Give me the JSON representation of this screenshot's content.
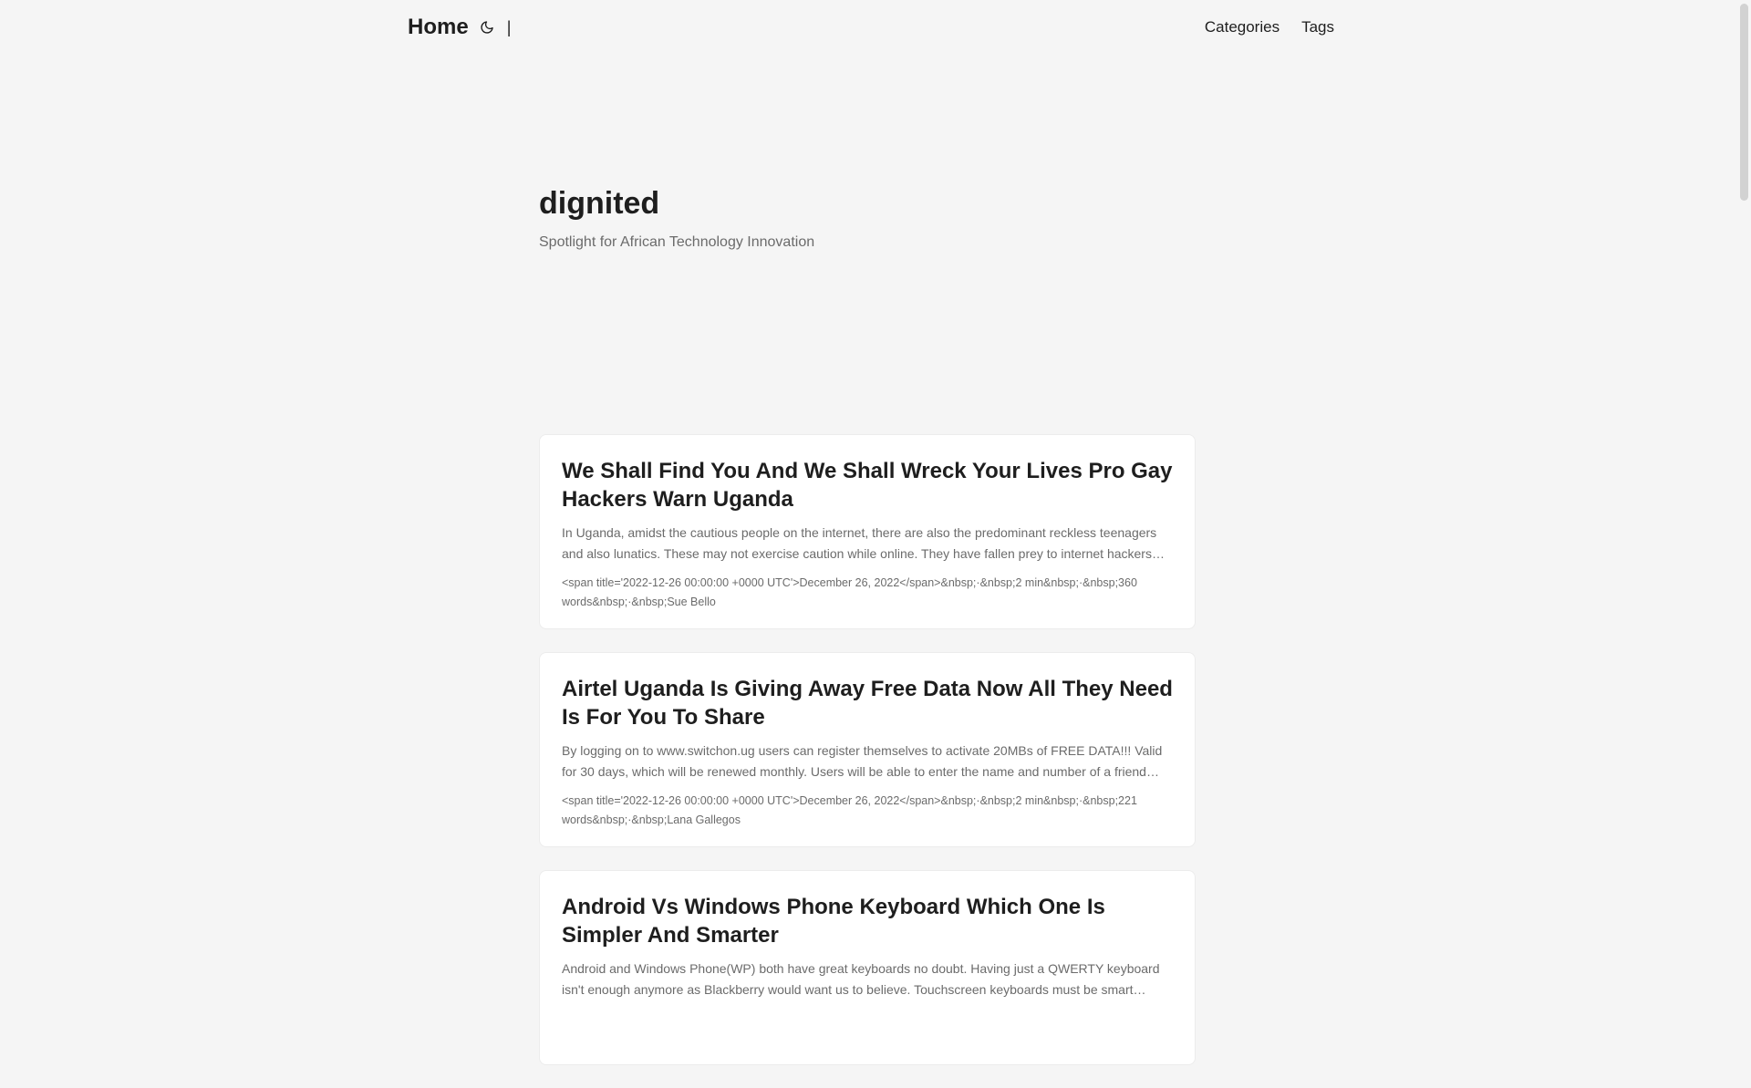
{
  "header": {
    "logo": "Home",
    "theme_icon": "moon-icon",
    "separator": "|",
    "menu": [
      {
        "label": "Categories"
      },
      {
        "label": "Tags"
      }
    ]
  },
  "home_info": {
    "title": "dignited",
    "description": "Spotlight for African Technology Innovation"
  },
  "posts": [
    {
      "title": "We Shall Find You And We Shall Wreck Your Lives Pro Gay Hackers Warn Uganda",
      "summary": "In Uganda, amidst the cautious people on the internet, there are also the predominant reckless teenagers and also lunatics. These may not exercise caution while online. They have fallen prey to internet hackers…",
      "meta": "<span title='2022-12-26 00:00:00 +0000 UTC'>December 26, 2022</span>&nbsp;·&nbsp;2 min&nbsp;·&nbsp;360 words&nbsp;·&nbsp;Sue Bello"
    },
    {
      "title": "Airtel Uganda Is Giving Away Free Data Now All They Need Is For You To Share",
      "summary": "By logging on to www.switchon.ug users can register themselves to activate 20MBs of FREE DATA!!! Valid for 30 days, which will be renewed monthly. Users will be able to enter the name and number of a friend…",
      "meta": "<span title='2022-12-26 00:00:00 +0000 UTC'>December 26, 2022</span>&nbsp;·&nbsp;2 min&nbsp;·&nbsp;221 words&nbsp;·&nbsp;Lana Gallegos"
    },
    {
      "title": "Android Vs Windows Phone Keyboard Which One Is Simpler And Smarter",
      "summary": "Android and Windows Phone(WP) both have great keyboards no doubt. Having just a QWERTY keyboard isn't enough anymore as Blackberry would want us to believe. Touchscreen keyboards must be smart…",
      "meta": ""
    }
  ]
}
